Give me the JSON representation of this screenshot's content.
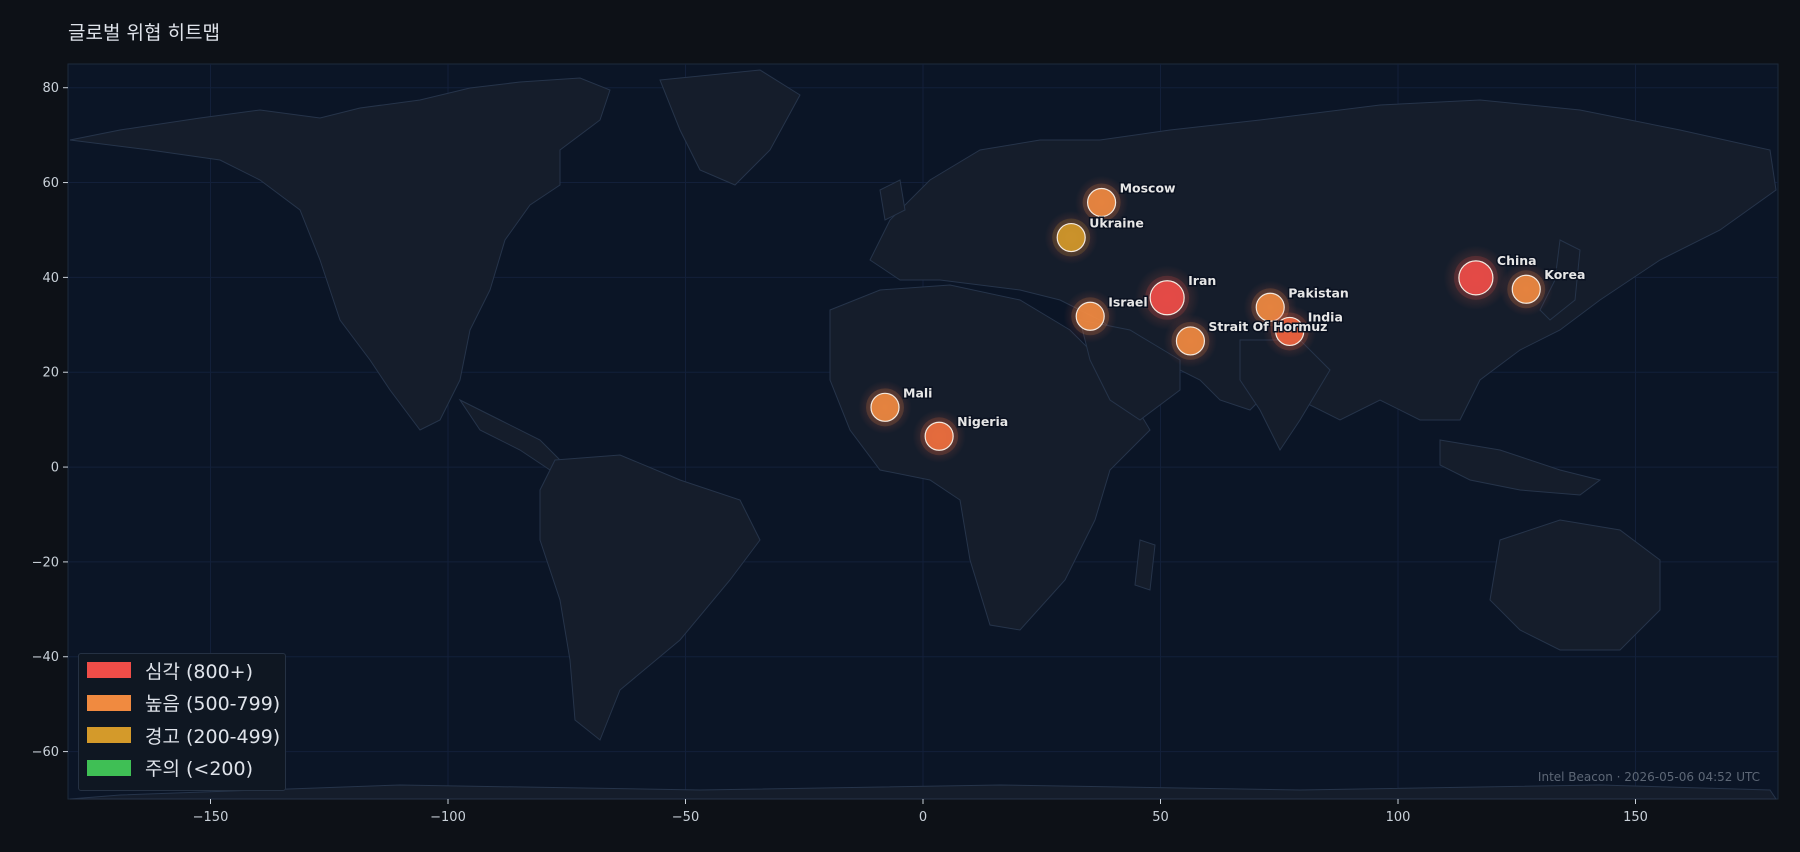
{
  "title": "글로벌 위협 히트맵",
  "footer": "Intel Beacon · 2026-05-06 04:52 UTC",
  "map": {
    "xlim": [
      -180,
      180
    ],
    "ylim": [
      -70,
      85
    ],
    "x_ticks": [
      -150,
      -100,
      -50,
      0,
      50,
      100,
      150
    ],
    "y_ticks": [
      80,
      60,
      40,
      20,
      0,
      -20,
      -40,
      -60
    ]
  },
  "legend": [
    {
      "label": "심각 (800+)",
      "color": "#f04d48"
    },
    {
      "label": "높음 (500-799)",
      "color": "#f08a40"
    },
    {
      "label": "경고 (200-499)",
      "color": "#d49a2a"
    },
    {
      "label": "주의 (<200)",
      "color": "#3fbf55"
    }
  ],
  "markers": [
    {
      "name": "Moscow",
      "lon": 37.6,
      "lat": 55.8,
      "level": "high",
      "color": "#f08a40"
    },
    {
      "name": "Ukraine",
      "lon": 31.2,
      "lat": 48.4,
      "level": "warning",
      "color": "#d49a2a"
    },
    {
      "name": "Iran",
      "lon": 51.4,
      "lat": 35.7,
      "level": "critical",
      "color": "#f04d48"
    },
    {
      "name": "Israel",
      "lon": 35.2,
      "lat": 31.8,
      "level": "high",
      "color": "#f08a40"
    },
    {
      "name": "Pakistan",
      "lon": 73.1,
      "lat": 33.7,
      "level": "high",
      "color": "#f08a40"
    },
    {
      "name": "India",
      "lon": 77.2,
      "lat": 28.6,
      "level": "high",
      "color": "#f0643e"
    },
    {
      "name": "Strait Of Hormuz",
      "lon": 56.3,
      "lat": 26.6,
      "level": "high",
      "color": "#f08a40"
    },
    {
      "name": "China",
      "lon": 116.4,
      "lat": 39.9,
      "level": "critical",
      "color": "#f04d48"
    },
    {
      "name": "Korea",
      "lon": 127.0,
      "lat": 37.5,
      "level": "high",
      "color": "#f08a40"
    },
    {
      "name": "Mali",
      "lon": -8.0,
      "lat": 12.6,
      "level": "high",
      "color": "#f08a40"
    },
    {
      "name": "Nigeria",
      "lon": 3.4,
      "lat": 6.5,
      "level": "high",
      "color": "#f0703e"
    }
  ]
}
